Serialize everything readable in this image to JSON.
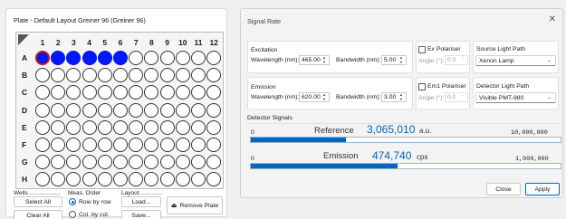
{
  "plate_panel": {
    "title": "Plate - Default Layout Greiner 96 (Greiner 96)",
    "columns": [
      "1",
      "2",
      "3",
      "4",
      "5",
      "6",
      "7",
      "8",
      "9",
      "10",
      "11",
      "12"
    ],
    "rows": [
      "A",
      "B",
      "C",
      "D",
      "E",
      "F",
      "G",
      "H"
    ],
    "selected_wells": [
      "A1",
      "A2",
      "A3",
      "A4",
      "A5",
      "A6"
    ],
    "current_well": "A1",
    "wells_group": {
      "label": "Wells",
      "select_all": "Select All",
      "clear_all": "Clear All"
    },
    "meas_order": {
      "label": "Meas. Order",
      "row_by_row": "Row by row",
      "col_by_col": "Col. by col.",
      "selected": "Row by row"
    },
    "layout_group": {
      "label": "Layout",
      "load": "Load...",
      "save": "Save..."
    },
    "remove_plate": "Remove Plate",
    "colors": {
      "selected": "#0018ff",
      "current_border": "#c0141c"
    }
  },
  "signal_rate": {
    "title": "Signal Rate",
    "excitation": {
      "label": "Excitation",
      "wavelength_label": "Wavelength (nm):",
      "wavelength_value": "465.00",
      "bandwidth_label": "Bandwidth (nm):",
      "bandwidth_value": "5.00",
      "polariser_label": "Ex Polariser",
      "angle_label": "Angle (°):",
      "angle_value": "0.0",
      "light_path_label": "Source Light Path",
      "light_path_value": "Xenon Lamp"
    },
    "emission": {
      "label": "Emission",
      "wavelength_label": "Wavelength (nm):",
      "wavelength_value": "620.00",
      "bandwidth_label": "Bandwidth (nm):",
      "bandwidth_value": "3.00",
      "polariser_label": "Em1 Polariser",
      "angle_label": "Angle (°):",
      "angle_value": "0.0",
      "light_path_label": "Detector Light Path",
      "light_path_value": "Visible PMT-980"
    },
    "detector_signals": {
      "label": "Detector Signals",
      "reference": {
        "name": "Reference",
        "value": "3,065,010",
        "unit": "a.u.",
        "min": "0",
        "max": "10,000,000",
        "fraction": 0.3065
      },
      "emission": {
        "name": "Emission",
        "value": "474,740",
        "unit": "cps",
        "min": "0",
        "max": "1,000,000",
        "fraction": 0.4747
      }
    },
    "close_label": "Close",
    "apply_label": "Apply",
    "accent": "#0067c0"
  }
}
